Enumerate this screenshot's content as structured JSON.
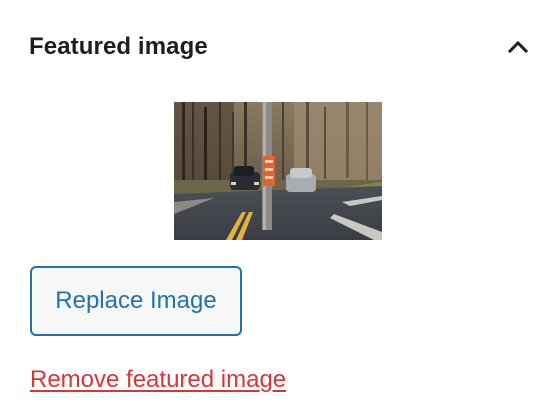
{
  "panel": {
    "title": "Featured image",
    "toggle_icon": "chevron-up-icon",
    "expanded": true
  },
  "thumbnail": {
    "description_icon": "featured-image-thumbnail"
  },
  "actions": {
    "replace_label": "Replace Image",
    "remove_label": "Remove featured image"
  },
  "colors": {
    "title": "#1e1e1e",
    "primary": "#2271b1",
    "button_bg": "#f6f7f7",
    "destructive": "#d63638"
  }
}
